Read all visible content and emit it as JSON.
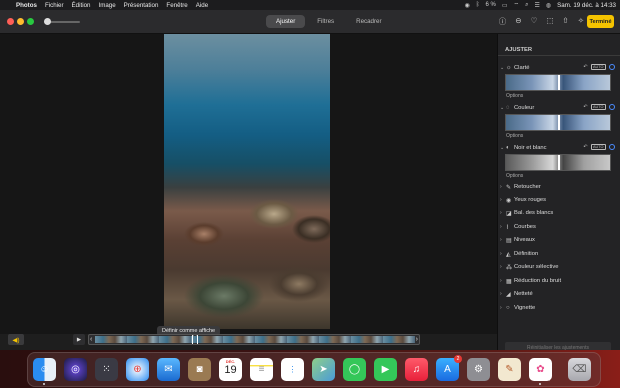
{
  "menubar": {
    "app": "Photos",
    "items": [
      "Fichier",
      "Édition",
      "Image",
      "Présentation",
      "Fenêtre",
      "Aide"
    ],
    "battery": "6 %",
    "datetime": "Sam. 19 déc. à 14:33"
  },
  "toolbar": {
    "tabs": [
      "Ajuster",
      "Filtres",
      "Recadrer"
    ],
    "active_tab": "Ajuster",
    "done_label": "Terminé"
  },
  "video": {
    "tooltip": "Définir comme affiche"
  },
  "sidebar": {
    "title": "AJUSTER",
    "sections": [
      {
        "label": "Clarté",
        "auto": "AUTO",
        "options": "Options"
      },
      {
        "label": "Couleur",
        "auto": "AUTO",
        "options": "Options"
      },
      {
        "label": "Noir et blanc",
        "auto": "AUTO",
        "options": "Options"
      }
    ],
    "tools": [
      "Retoucher",
      "Yeux rouges",
      "Bal. des blancs",
      "Courbes",
      "Niveaux",
      "Définition",
      "Couleur sélective",
      "Réduction du bruit",
      "Netteté",
      "Vignette"
    ],
    "reset_label": "Réinitialiser les ajustements"
  },
  "dock": {
    "calendar_month": "DÉC.",
    "calendar_day": "19",
    "appstore_badge": "2"
  }
}
